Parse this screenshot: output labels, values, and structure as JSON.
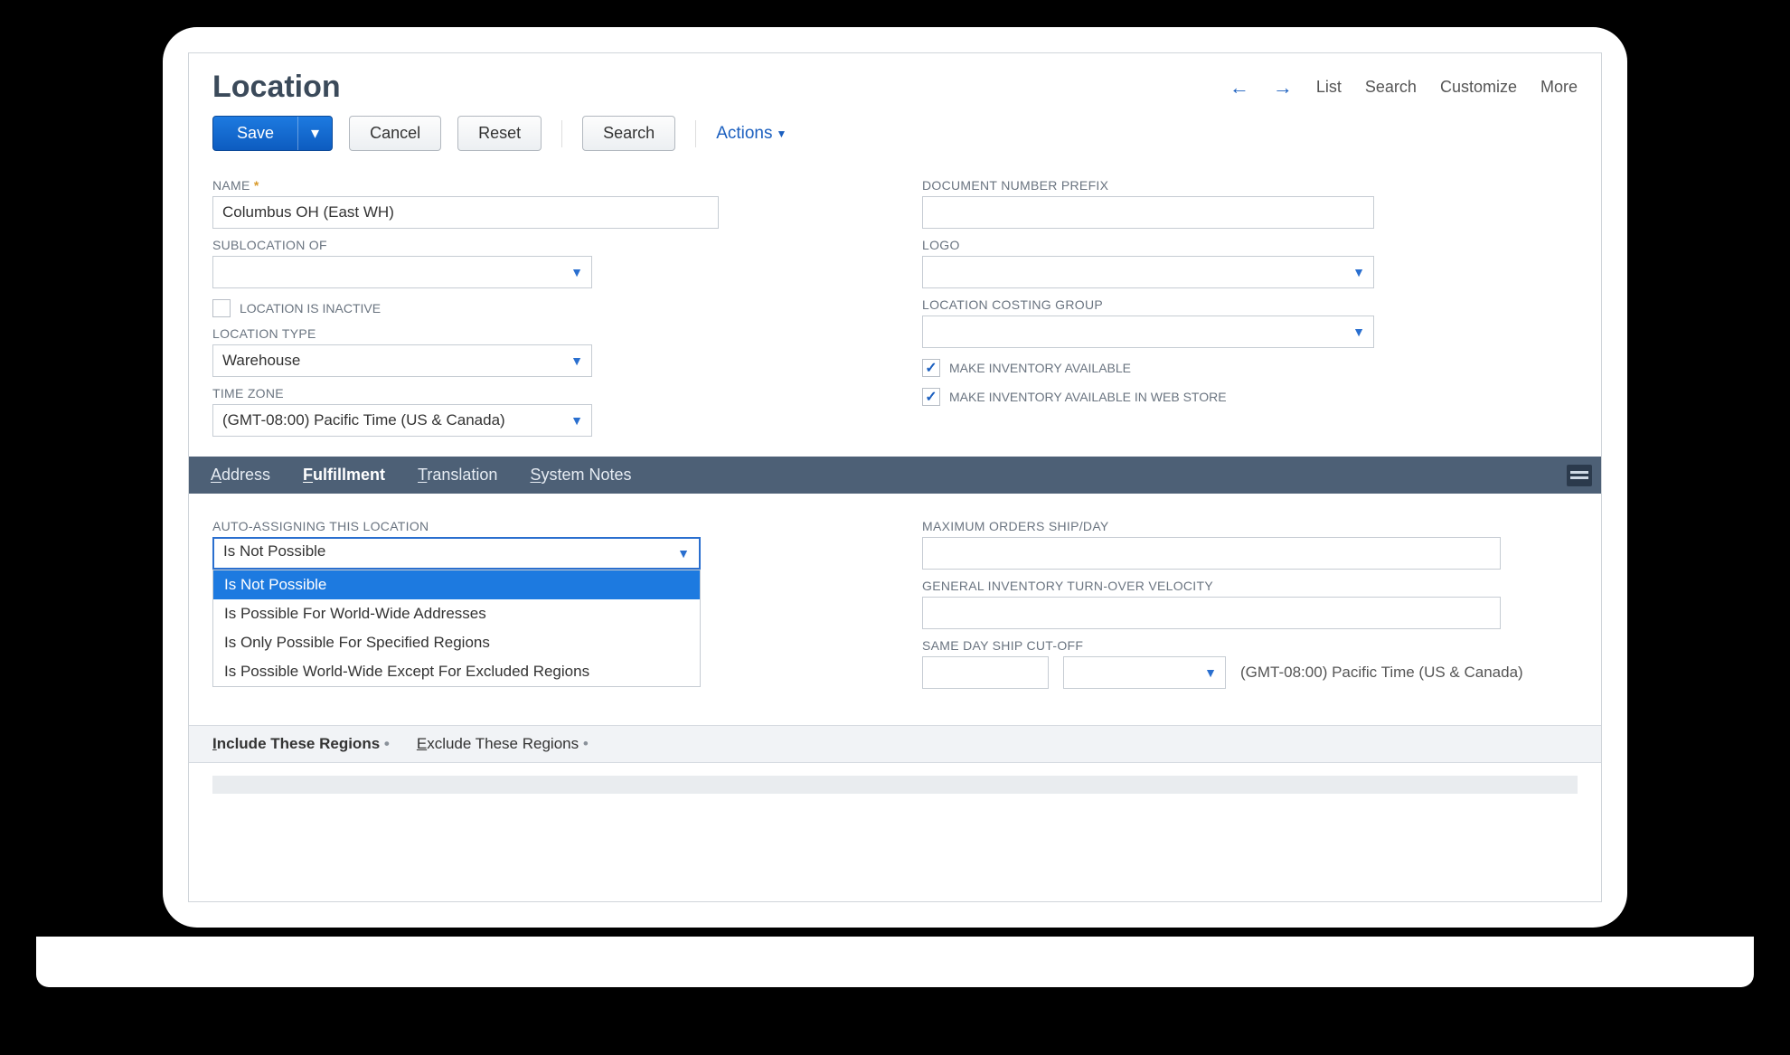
{
  "header": {
    "title": "Location",
    "links": [
      "List",
      "Search",
      "Customize",
      "More"
    ]
  },
  "toolbar": {
    "save": "Save",
    "cancel": "Cancel",
    "reset": "Reset",
    "search": "Search",
    "actions": "Actions"
  },
  "left_fields": {
    "name_label": "NAME",
    "name_value": "Columbus OH (East WH)",
    "sublocation_label": "SUBLOCATION OF",
    "sublocation_value": "",
    "inactive_label": "LOCATION IS INACTIVE",
    "inactive_checked": false,
    "type_label": "LOCATION TYPE",
    "type_value": "Warehouse",
    "tz_label": "TIME ZONE",
    "tz_value": "(GMT-08:00) Pacific Time (US & Canada)"
  },
  "right_fields": {
    "docprefix_label": "DOCUMENT NUMBER PREFIX",
    "docprefix_value": "",
    "logo_label": "LOGO",
    "logo_value": "",
    "costing_label": "LOCATION COSTING GROUP",
    "costing_value": "",
    "inv_avail_label": "MAKE INVENTORY AVAILABLE",
    "inv_avail_web_label": "MAKE INVENTORY AVAILABLE IN WEB STORE"
  },
  "tabs": {
    "address": "Address",
    "fulfillment": "Fulfillment",
    "translation": "Translation",
    "system_notes": "System Notes"
  },
  "fulfillment": {
    "auto_label": "AUTO-ASSIGNING THIS LOCATION",
    "auto_value": "Is Not Possible",
    "options": [
      "Is Not Possible",
      "Is Possible For World-Wide Addresses",
      "Is Only Possible For Specified Regions",
      "Is Possible World-Wide Except For Excluded Regions"
    ],
    "max_orders_label": "MAXIMUM ORDERS SHIP/DAY",
    "max_orders_value": "",
    "velocity_label": "GENERAL INVENTORY TURN-OVER VELOCITY",
    "velocity_value": "",
    "cutoff_label": "SAME DAY SHIP CUT-OFF",
    "cutoff_hour": "",
    "cutoff_ampm": "",
    "cutoff_tz": "(GMT-08:00) Pacific Time (US & Canada)"
  },
  "subtabs": {
    "include": "Include These Regions",
    "exclude": "Exclude These Regions"
  }
}
